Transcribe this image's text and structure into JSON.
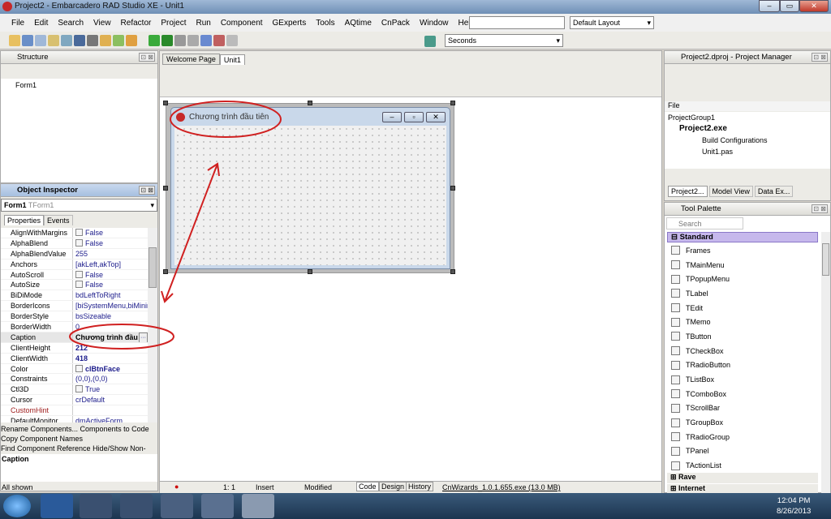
{
  "window": {
    "title": "Project2 - Embarcadero RAD Studio XE - Unit1"
  },
  "menu": [
    "File",
    "Edit",
    "Search",
    "View",
    "Refactor",
    "Project",
    "Run",
    "Component",
    "GExperts",
    "Tools",
    "AQtime",
    "CnPack",
    "Window",
    "Help"
  ],
  "layout_combo": "Default Layout",
  "seconds_combo": "Seconds",
  "structure": {
    "title": "Structure",
    "tree": [
      "Form1"
    ]
  },
  "editor_tabs": [
    "Welcome Page",
    "Unit1"
  ],
  "inspector": {
    "title": "Object Inspector",
    "selected": "Form1",
    "selected_type": "TForm1",
    "tabs": [
      "Properties",
      "Events"
    ],
    "props": [
      {
        "n": "AlignWithMargins",
        "v": "False",
        "chk": true
      },
      {
        "n": "AlphaBlend",
        "v": "False",
        "chk": true
      },
      {
        "n": "AlphaBlendValue",
        "v": "255"
      },
      {
        "n": "Anchors",
        "v": "[akLeft,akTop]",
        "plus": true
      },
      {
        "n": "AutoScroll",
        "v": "False",
        "chk": true
      },
      {
        "n": "AutoSize",
        "v": "False",
        "chk": true
      },
      {
        "n": "BiDiMode",
        "v": "bdLeftToRight"
      },
      {
        "n": "BorderIcons",
        "v": "[biSystemMenu,biMinim",
        "plus": true
      },
      {
        "n": "BorderStyle",
        "v": "bsSizeable"
      },
      {
        "n": "BorderWidth",
        "v": "0"
      },
      {
        "n": "Caption",
        "v": "Chương trình đầu",
        "sel": true
      },
      {
        "n": "ClientHeight",
        "v": "212",
        "bold": true
      },
      {
        "n": "ClientWidth",
        "v": "418",
        "bold": true
      },
      {
        "n": "Color",
        "v": "clBtnFace",
        "chk": true,
        "bold": true
      },
      {
        "n": "Constraints",
        "v": "(0,0),(0,0)",
        "plus": true
      },
      {
        "n": "Ctl3D",
        "v": "True",
        "chk": true
      },
      {
        "n": "Cursor",
        "v": "crDefault"
      },
      {
        "n": "CustomHint",
        "v": "",
        "red": true
      },
      {
        "n": "DefaultMonitor",
        "v": "dmActiveForm"
      }
    ],
    "actions": [
      "Rename Components...  Components to Code",
      "Copy Component Names",
      "Find Component Reference  Hide/Show Non-Visual"
    ],
    "desc_title": "Caption",
    "status": "All shown"
  },
  "form": {
    "caption": "Chương trình đầu tiên"
  },
  "statusbar": {
    "pos": "1:  1",
    "mode": "Insert",
    "state": "Modified",
    "tabs": [
      "Code",
      "Design",
      "History"
    ],
    "link": "CnWizards_1.0.1.655.exe (13.0 MB)"
  },
  "project_manager": {
    "title": "Project2.dproj - Project Manager",
    "col": "File",
    "tree": [
      "ProjectGroup1",
      "Project2.exe",
      "Build Configurations",
      "Unit1.pas"
    ],
    "tabs": [
      "Project2...",
      "Model View",
      "Data Ex..."
    ]
  },
  "palette": {
    "title": "Tool Palette",
    "search": "Search",
    "category": "Standard",
    "items": [
      "Frames",
      "TMainMenu",
      "TPopupMenu",
      "TLabel",
      "TEdit",
      "TMemo",
      "TButton",
      "TCheckBox",
      "TRadioButton",
      "TListBox",
      "TComboBox",
      "TScrollBar",
      "TGroupBox",
      "TRadioGroup",
      "TPanel",
      "TActionList"
    ],
    "more": [
      "Rave",
      "Internet"
    ]
  },
  "taskbar": {
    "time": "12:04 PM",
    "date": "8/26/2013"
  }
}
